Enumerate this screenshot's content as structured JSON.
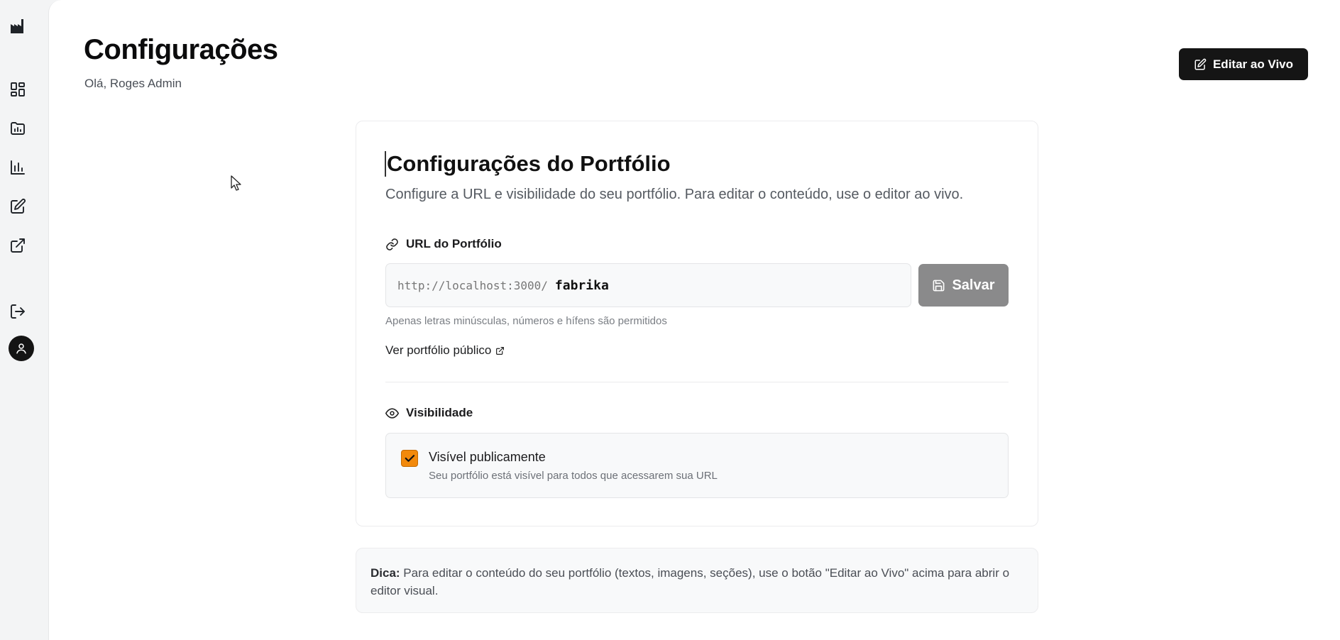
{
  "sidebar": {
    "items": [
      {
        "icon": "factory-logo-icon"
      },
      {
        "icon": "dashboard-icon"
      },
      {
        "icon": "projects-folder-icon"
      },
      {
        "icon": "analytics-chart-icon"
      },
      {
        "icon": "edit-icon"
      },
      {
        "icon": "external-link-icon"
      },
      {
        "icon": "logout-icon"
      },
      {
        "icon": "user-avatar-icon"
      }
    ]
  },
  "header": {
    "title": "Configurações",
    "greeting": "Olá, Roges Admin",
    "live_button_label": "Editar ao Vivo"
  },
  "card": {
    "title": "Configurações do Portfólio",
    "description": "Configure a URL e visibilidade do seu portfólio. Para editar o conteúdo, use o editor ao vivo.",
    "url_section_label": "URL do Portfólio",
    "url_prefix": "http://localhost:3000/",
    "url_value": "fabrika",
    "save_label": "Salvar",
    "hint": "Apenas letras minúsculas, números e hífens são permitidos",
    "public_link_label": "Ver portfólio público",
    "visibility_section_label": "Visibilidade",
    "visibility_title": "Visível publicamente",
    "visibility_subtitle": "Seu portfólio está visível para todos que acessarem sua URL",
    "visibility_checked": true
  },
  "tip": {
    "label": "Dica:",
    "text": " Para editar o conteúdo do seu portfólio (textos, imagens, seções), use o botão \"Editar ao Vivo\" acima para abrir o editor visual."
  },
  "colors": {
    "accent_checkbox": "#f2890b",
    "primary_button": "#151515",
    "save_button": "#8a8a8b"
  }
}
